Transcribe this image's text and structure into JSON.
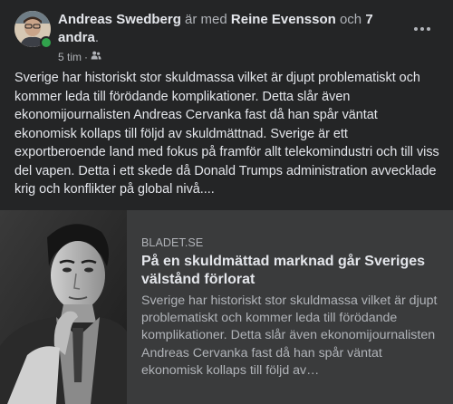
{
  "post": {
    "author": "Andreas Swedberg",
    "with_word": "är med",
    "tagged_person": "Reine Evensson",
    "and_word": "och",
    "others": "7 andra",
    "period": ".",
    "time": "5 tim",
    "time_separator": "·",
    "audience_icon": "friends-icon",
    "more_icon": "more-horizontal-icon",
    "text": "Sverige har historiskt stor skuldmassa vilket är djupt problematiskt och kommer leda till förödande komplikationer. Detta slår även ekonomijournalisten Andreas Cervanka fast då han spår väntat ekonomisk kollaps till följd av skuldmättnad. Sverige är ett exportberoende land med fokus på framför allt telekomindustri och till viss del vapen. Detta i ett skede då Donald Trumps administration avvecklade krig och konflikter på global nivå...."
  },
  "link": {
    "domain": "BLADET.SE",
    "title": "På en skuldmättad marknad går Sveriges välstånd förlorat",
    "description": "Sverige har historiskt stor skuldmassa vilket är djupt problematiskt och kommer leda till förödande komplikationer. Detta slår även ekonomijournalisten Andreas Cervanka fast då han spår väntat ekonomisk kollaps till följd av…"
  },
  "colors": {
    "background": "#242526",
    "card": "#3a3b3c",
    "primary_text": "#e4e6eb",
    "secondary_text": "#b0b3b8",
    "online": "#31a24c"
  }
}
